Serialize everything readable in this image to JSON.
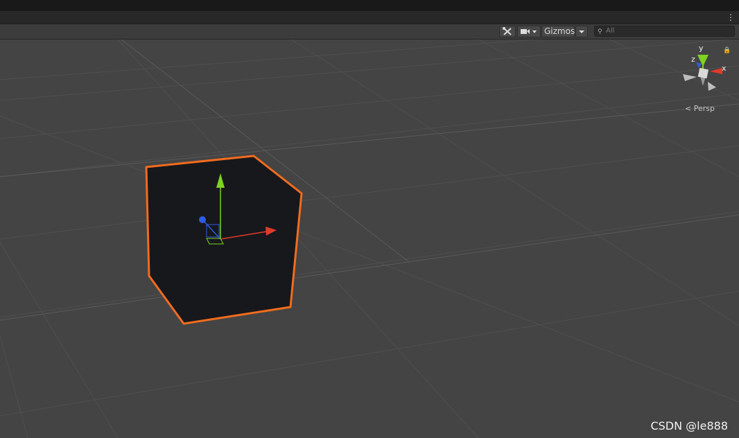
{
  "toolbar": {
    "tools_icon": "wrench-cross-icon",
    "camera_icon": "camera-icon",
    "gizmos_label": "Gizmos",
    "search_placeholder": "All",
    "more_icon": "vertical-ellipsis-icon"
  },
  "scene_gizmo": {
    "axis_y": "y",
    "axis_z": "z",
    "axis_x": "x",
    "projection_label": "< Persp",
    "colors": {
      "x": "#e23a2a",
      "y": "#7ed321",
      "z": "#2f5ce0"
    }
  },
  "selection": {
    "outline_color": "#f26c1e",
    "cube_color": "#17181c"
  },
  "watermark": "CSDN @le888"
}
